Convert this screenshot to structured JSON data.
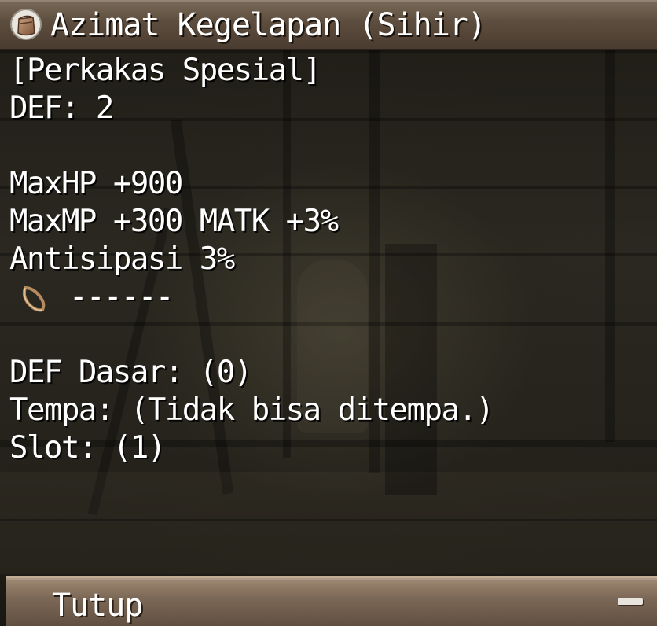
{
  "window": {
    "title": "Azimat Kegelapan (Sihir)",
    "title_icon": "pouch-icon"
  },
  "details": {
    "category": "[Perkakas Spesial]",
    "def": "DEF: 2",
    "stats": [
      "MaxHP +900",
      "MaxMP +300 MATK +3%",
      "Antisipasi 3%"
    ],
    "slot_icon": "empty-slot-icon",
    "slot_text": "------",
    "base_def": "DEF Dasar: (0)",
    "refine": "Tempa: (Tidak bisa ditempa.)",
    "slot_count": "Slot: (1)"
  },
  "footer": {
    "close_label": "Tutup",
    "minimize_icon": "minus-icon"
  },
  "colors": {
    "title_bar": "#5d4d3e",
    "footer_bar": "#7c6856",
    "text": "#ffffff"
  }
}
